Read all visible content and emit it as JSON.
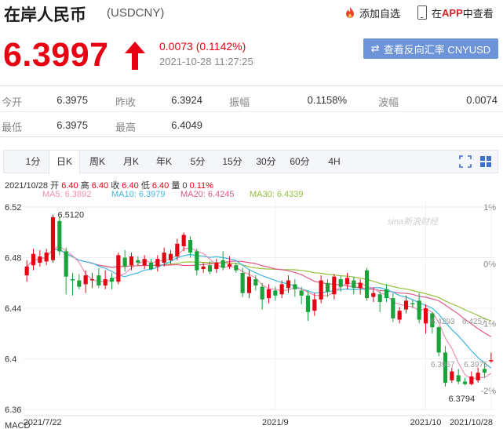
{
  "header": {
    "title": "在岸人民币",
    "code": "(USDCNY)",
    "watch_label": "添加自选",
    "app_label_prefix": "在",
    "app_label_highlight": "APP",
    "app_label_suffix": "中查看"
  },
  "quote": {
    "price": "6.3997",
    "direction": "up",
    "change": "0.0073 (0.1142%)",
    "time": "2021-10-28 11:27:25",
    "reverse_button": "查看反向汇率 CNYUSD"
  },
  "stats": [
    {
      "label": "今开",
      "value": "6.3975"
    },
    {
      "label": "昨收",
      "value": "6.3924"
    },
    {
      "label": "振幅",
      "value": "0.1158%"
    },
    {
      "label": "波幅",
      "value": "0.0074"
    },
    {
      "label": "最低",
      "value": "6.3975"
    },
    {
      "label": "最高",
      "value": "6.4049"
    }
  ],
  "tabs": [
    "1分",
    "日K",
    "周K",
    "月K",
    "年K",
    "5分",
    "15分",
    "30分",
    "60分",
    "4H"
  ],
  "active_tab": "日K",
  "ohlc": {
    "date": "2021/10/28",
    "open_label": "开",
    "open": "6.40",
    "high_label": "高",
    "high": "6.40",
    "close_label": "收",
    "close": "6.40",
    "low_label": "低",
    "low": "6.40",
    "volume_label": "量",
    "volume": "0",
    "pct": "0.11%"
  },
  "ma_legend": [
    {
      "text": "MA5: 6.3892",
      "color": "#f08fb4"
    },
    {
      "text": "MA10: 6.3979",
      "color": "#3fb7e3"
    },
    {
      "text": "MA20: 6.4245",
      "color": "#e05a8a"
    },
    {
      "text": "MA30: 6.4339",
      "color": "#94c13c"
    }
  ],
  "watermark": "sina新浪财经",
  "macd_label": "MACD",
  "chart_data": {
    "type": "candlestick",
    "x_ticks": [
      "2021/7/22",
      "2021/9",
      "2021/10",
      "2021/10/28"
    ],
    "y_ticks": [
      "6.52",
      "6.48",
      "6.44",
      "6.4",
      "6.36"
    ],
    "y_right_ticks": [
      "1%",
      "0%",
      "-1%",
      "-2%"
    ],
    "ylim": [
      6.36,
      6.525
    ],
    "up_color": "#e60012",
    "down_color": "#1aa23b",
    "annotations": {
      "max_label": "6.5120",
      "min_label": "6.3794",
      "ma20_end_label": "6.4293",
      "ma30_end_label": "6.4257",
      "ma5_end_label": "6.3967",
      "ma10_end_label": "6.3975"
    },
    "candles": [
      {
        "o": 6.466,
        "c": 6.473,
        "h": 6.478,
        "l": 6.461
      },
      {
        "o": 6.474,
        "c": 6.483,
        "h": 6.487,
        "l": 6.47
      },
      {
        "o": 6.476,
        "c": 6.481,
        "h": 6.486,
        "l": 6.473
      },
      {
        "o": 6.477,
        "c": 6.484,
        "h": 6.487,
        "l": 6.474
      },
      {
        "o": 6.478,
        "c": 6.512,
        "h": 6.514,
        "l": 6.476
      },
      {
        "o": 6.509,
        "c": 6.485,
        "h": 6.512,
        "l": 6.482
      },
      {
        "o": 6.485,
        "c": 6.465,
        "h": 6.488,
        "l": 6.451
      },
      {
        "o": 6.463,
        "c": 6.462,
        "h": 6.468,
        "l": 6.45
      },
      {
        "o": 6.462,
        "c": 6.457,
        "h": 6.467,
        "l": 6.455
      },
      {
        "o": 6.459,
        "c": 6.466,
        "h": 6.47,
        "l": 6.452
      },
      {
        "o": 6.462,
        "c": 6.463,
        "h": 6.468,
        "l": 6.456
      },
      {
        "o": 6.466,
        "c": 6.458,
        "h": 6.472,
        "l": 6.456
      },
      {
        "o": 6.458,
        "c": 6.463,
        "h": 6.47,
        "l": 6.455
      },
      {
        "o": 6.464,
        "c": 6.461,
        "h": 6.468,
        "l": 6.455
      },
      {
        "o": 6.461,
        "c": 6.482,
        "h": 6.484,
        "l": 6.459
      },
      {
        "o": 6.48,
        "c": 6.473,
        "h": 6.486,
        "l": 6.469
      },
      {
        "o": 6.474,
        "c": 6.481,
        "h": 6.484,
        "l": 6.47
      },
      {
        "o": 6.478,
        "c": 6.476,
        "h": 6.481,
        "l": 6.474
      },
      {
        "o": 6.474,
        "c": 6.479,
        "h": 6.482,
        "l": 6.471
      },
      {
        "o": 6.476,
        "c": 6.471,
        "h": 6.479,
        "l": 6.47
      },
      {
        "o": 6.473,
        "c": 6.479,
        "h": 6.482,
        "l": 6.469
      },
      {
        "o": 6.476,
        "c": 6.484,
        "h": 6.488,
        "l": 6.473
      },
      {
        "o": 6.478,
        "c": 6.483,
        "h": 6.486,
        "l": 6.475
      },
      {
        "o": 6.481,
        "c": 6.491,
        "h": 6.495,
        "l": 6.478
      },
      {
        "o": 6.489,
        "c": 6.498,
        "h": 6.5,
        "l": 6.485
      },
      {
        "o": 6.494,
        "c": 6.484,
        "h": 6.497,
        "l": 6.48
      },
      {
        "o": 6.485,
        "c": 6.47,
        "h": 6.487,
        "l": 6.466
      },
      {
        "o": 6.471,
        "c": 6.473,
        "h": 6.476,
        "l": 6.468
      },
      {
        "o": 6.474,
        "c": 6.469,
        "h": 6.477,
        "l": 6.467
      },
      {
        "o": 6.471,
        "c": 6.476,
        "h": 6.479,
        "l": 6.468
      },
      {
        "o": 6.478,
        "c": 6.472,
        "h": 6.485,
        "l": 6.47
      },
      {
        "o": 6.473,
        "c": 6.475,
        "h": 6.481,
        "l": 6.471
      },
      {
        "o": 6.474,
        "c": 6.47,
        "h": 6.476,
        "l": 6.468
      },
      {
        "o": 6.468,
        "c": 6.452,
        "h": 6.472,
        "l": 6.449
      },
      {
        "o": 6.452,
        "c": 6.465,
        "h": 6.47,
        "l": 6.448
      },
      {
        "o": 6.463,
        "c": 6.458,
        "h": 6.466,
        "l": 6.454
      },
      {
        "o": 6.457,
        "c": 6.447,
        "h": 6.46,
        "l": 6.439
      },
      {
        "o": 6.448,
        "c": 6.455,
        "h": 6.459,
        "l": 6.444
      },
      {
        "o": 6.454,
        "c": 6.45,
        "h": 6.457,
        "l": 6.446
      },
      {
        "o": 6.451,
        "c": 6.459,
        "h": 6.462,
        "l": 6.448
      },
      {
        "o": 6.456,
        "c": 6.462,
        "h": 6.466,
        "l": 6.452
      },
      {
        "o": 6.459,
        "c": 6.455,
        "h": 6.463,
        "l": 6.449
      },
      {
        "o": 6.454,
        "c": 6.45,
        "h": 6.457,
        "l": 6.443
      },
      {
        "o": 6.45,
        "c": 6.437,
        "h": 6.454,
        "l": 6.43
      },
      {
        "o": 6.438,
        "c": 6.447,
        "h": 6.452,
        "l": 6.434
      },
      {
        "o": 6.447,
        "c": 6.462,
        "h": 6.466,
        "l": 6.444
      },
      {
        "o": 6.46,
        "c": 6.453,
        "h": 6.463,
        "l": 6.449
      },
      {
        "o": 6.451,
        "c": 6.465,
        "h": 6.467,
        "l": 6.447
      },
      {
        "o": 6.463,
        "c": 6.457,
        "h": 6.466,
        "l": 6.453
      },
      {
        "o": 6.459,
        "c": 6.464,
        "h": 6.468,
        "l": 6.455
      },
      {
        "o": 6.462,
        "c": 6.456,
        "h": 6.465,
        "l": 6.451
      },
      {
        "o": 6.456,
        "c": 6.46,
        "h": 6.463,
        "l": 6.451
      },
      {
        "o": 6.47,
        "c": 6.448,
        "h": 6.472,
        "l": 6.446
      },
      {
        "o": 6.449,
        "c": 6.452,
        "h": 6.456,
        "l": 6.445
      },
      {
        "o": 6.451,
        "c": 6.445,
        "h": 6.454,
        "l": 6.437
      },
      {
        "o": 6.455,
        "c": 6.448,
        "h": 6.459,
        "l": 6.445
      },
      {
        "o": 6.448,
        "c": 6.432,
        "h": 6.452,
        "l": 6.429
      },
      {
        "o": 6.431,
        "c": 6.438,
        "h": 6.441,
        "l": 6.428
      },
      {
        "o": 6.439,
        "c": 6.446,
        "h": 6.45,
        "l": 6.436
      },
      {
        "o": 6.444,
        "c": 6.443,
        "h": 6.447,
        "l": 6.44
      },
      {
        "o": 6.446,
        "c": 6.431,
        "h": 6.452,
        "l": 6.428
      },
      {
        "o": 6.428,
        "c": 6.44,
        "h": 6.443,
        "l": 6.42
      },
      {
        "o": 6.436,
        "c": 6.425,
        "h": 6.437,
        "l": 6.42
      },
      {
        "o": 6.425,
        "c": 6.405,
        "h": 6.426,
        "l": 6.402
      },
      {
        "o": 6.405,
        "c": 6.381,
        "h": 6.41,
        "l": 6.378
      },
      {
        "o": 6.383,
        "c": 6.39,
        "h": 6.393,
        "l": 6.381
      },
      {
        "o": 6.387,
        "c": 6.382,
        "h": 6.392,
        "l": 6.38
      },
      {
        "o": 6.382,
        "c": 6.38,
        "h": 6.385,
        "l": 6.379
      },
      {
        "o": 6.38,
        "c": 6.386,
        "h": 6.39,
        "l": 6.379
      },
      {
        "o": 6.383,
        "c": 6.389,
        "h": 6.393,
        "l": 6.381
      },
      {
        "o": 6.392,
        "c": 6.389,
        "h": 6.397,
        "l": 6.385
      },
      {
        "o": 6.398,
        "c": 6.399,
        "h": 6.405,
        "l": 6.397
      }
    ]
  }
}
